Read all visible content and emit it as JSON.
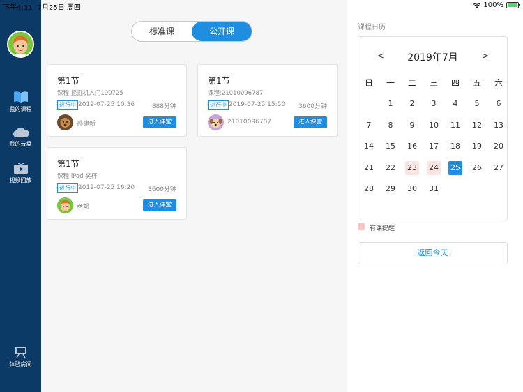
{
  "status_bar": {
    "time": "下午4:31",
    "date": "7月25日 周四",
    "battery": "100%"
  },
  "sidebar": {
    "items": [
      {
        "label": "我的课程",
        "icon": "book-icon"
      },
      {
        "label": "我的云盘",
        "icon": "cloud-icon"
      },
      {
        "label": "视频回放",
        "icon": "video-play-icon"
      },
      {
        "label": "体验房间",
        "icon": "classroom-icon"
      }
    ]
  },
  "tabs": {
    "standard": "标准课",
    "public": "公开课",
    "active": "公开课"
  },
  "cards": [
    {
      "title": "第1节",
      "course": "课程:挖掘机入门190725",
      "status": "进行中",
      "time": "2019-07-25 10:36",
      "duration": "888分钟",
      "teacher": "孙建新",
      "button": "进入课堂"
    },
    {
      "title": "第1节",
      "course": "课程:21010096787",
      "status": "进行中",
      "time": "2019-07-25 15:50",
      "duration": "3600分钟",
      "teacher": "21010096787",
      "button": "进入课堂"
    },
    {
      "title": "第1节",
      "course": "课程:iPad 奖杯",
      "status": "进行中",
      "time": "2019-07-25 16:20",
      "duration": "3600分钟",
      "teacher": "老郑",
      "button": "进入课堂"
    }
  ],
  "calendar": {
    "heading": "课程日历",
    "month_title": "2019年7月",
    "prev": "<",
    "next": ">",
    "weekdays": [
      "日",
      "一",
      "二",
      "三",
      "四",
      "五",
      "六"
    ],
    "first_weekday_index": 1,
    "days_in_month": 31,
    "reminder_days": [
      23,
      24
    ],
    "selected_day": 25,
    "legend": "有课提醒",
    "today_button": "返回今天"
  },
  "colors": {
    "sidebar": "#0c3a66",
    "accent": "#1f8ee0",
    "reminder": "#f8c5c2"
  }
}
